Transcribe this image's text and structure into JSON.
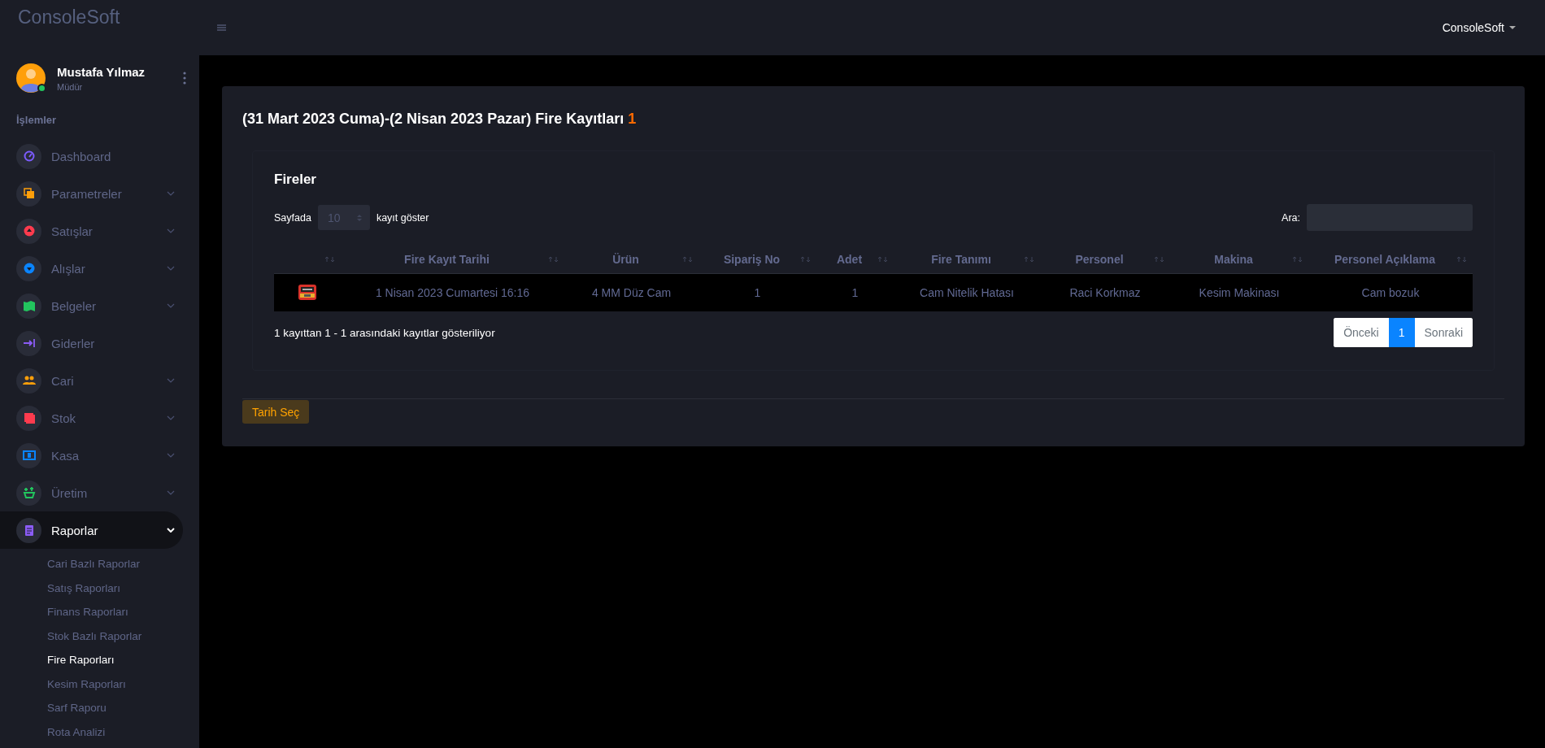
{
  "sidebar": {
    "logo": "ConsoleSoft",
    "user": {
      "name": "Mustafa Yılmaz",
      "role": "Müdür",
      "online": true
    },
    "section_title": "İşlemler",
    "items": [
      {
        "label": "Dashboard",
        "kind": "gauge",
        "color": "#7c5cff",
        "selected": false
      },
      {
        "label": "Parametreler",
        "kind": "copy",
        "color": "#ff9f0a",
        "expanded": false,
        "selected": false
      },
      {
        "label": "Satışlar",
        "kind": "up",
        "color": "#ff3b4e",
        "expanded": false,
        "selected": false
      },
      {
        "label": "Alışlar",
        "kind": "down",
        "color": "#0a84ff",
        "expanded": false,
        "selected": false
      },
      {
        "label": "Belgeler",
        "kind": "map",
        "color": "#22c55e",
        "expanded": false,
        "selected": false
      },
      {
        "label": "Giderler",
        "kind": "export",
        "color": "#8b5cf6",
        "selected": false
      },
      {
        "label": "Cari",
        "kind": "users",
        "color": "#ff9f0a",
        "expanded": false,
        "selected": false
      },
      {
        "label": "Stok",
        "kind": "layers",
        "color": "#ff3b4e",
        "expanded": false,
        "selected": false
      },
      {
        "label": "Kasa",
        "kind": "cash",
        "color": "#0a84ff",
        "expanded": false,
        "selected": false
      },
      {
        "label": "Üretim",
        "kind": "basket",
        "color": "#22c55e",
        "expanded": false,
        "selected": false
      },
      {
        "label": "Raporlar",
        "kind": "clipboard",
        "color": "#8b5cf6",
        "expanded": true,
        "selected": true,
        "children": [
          {
            "label": "Cari Bazlı Raporlar",
            "selected": false
          },
          {
            "label": "Satış Raporları",
            "selected": false
          },
          {
            "label": "Finans Raporları",
            "selected": false
          },
          {
            "label": "Stok Bazlı Raporlar",
            "selected": false
          },
          {
            "label": "Fire Raporları",
            "selected": true
          },
          {
            "label": "Kesim Raporları",
            "selected": false
          },
          {
            "label": "Sarf Raporu",
            "selected": false
          },
          {
            "label": "Rota Analizi",
            "selected": false
          }
        ]
      }
    ]
  },
  "topbar": {
    "account": "ConsoleSoft"
  },
  "page": {
    "title": "(31 Mart 2023 Cuma)-(2 Nisan 2023 Pazar) Fire Kayıtları",
    "count": "1",
    "table_card": {
      "title": "Fireler",
      "length_prefix": "Sayfada",
      "length_value": "10",
      "length_suffix": "kayıt göster",
      "search_label": "Ara:",
      "columns": [
        {
          "label": "Fire Kayıt Tarihi"
        },
        {
          "label": "Ürün"
        },
        {
          "label": "Sipariş No"
        },
        {
          "label": "Adet"
        },
        {
          "label": "Fire Tanımı"
        },
        {
          "label": "Personel"
        },
        {
          "label": "Makina"
        },
        {
          "label": "Personel Açıklama"
        }
      ],
      "rows": [
        {
          "cells": [
            "1 Nisan 2023 Cumartesi 16:16",
            "4 MM Düz Cam",
            "1",
            "1",
            "Cam Nitelik Hatası",
            "Raci Korkmaz",
            "Kesim Makinası",
            "Cam bozuk"
          ]
        }
      ],
      "info": "1 kayıttan 1 - 1 arasındaki kayıtlar gösteriliyor",
      "pagination": [
        {
          "label": "Önceki",
          "selected": false
        },
        {
          "label": "1",
          "selected": true
        },
        {
          "label": "Sonraki",
          "selected": false
        }
      ]
    },
    "date_button": "Tarih Seç"
  }
}
